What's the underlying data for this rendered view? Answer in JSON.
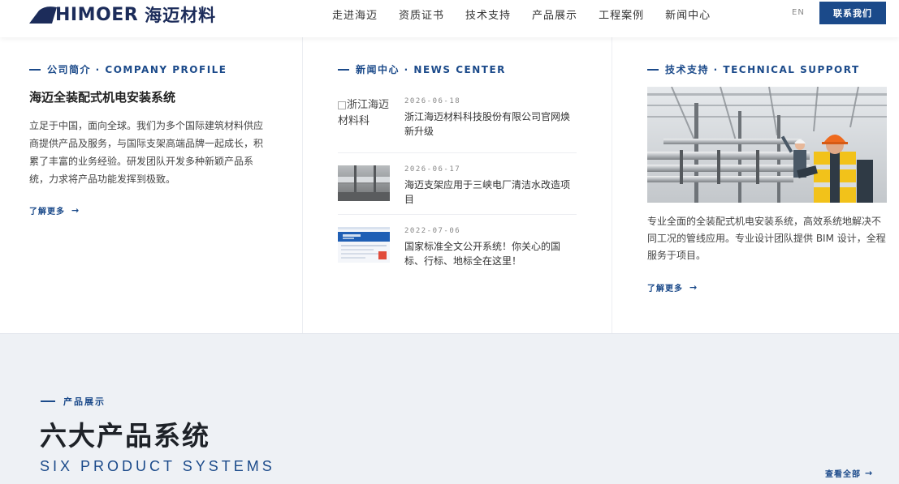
{
  "header": {
    "logo_text": "HIMOER",
    "logo_cn": "海迈材料",
    "nav": [
      "走进海迈",
      "资质证书",
      "技术支持",
      "产品展示",
      "工程案例",
      "新闻中心"
    ],
    "lang": "EN",
    "contact_label": "联系我们"
  },
  "company": {
    "section_title": "公司简介 · COMPANY PROFILE",
    "heading": "海迈全装配式机电安装系统",
    "description": "立足于中国，面向全球。我们为多个国际建筑材料供应商提供产品及服务，与国际支架高端品牌一起成长，积累了丰富的业务经验。研发团队开发多种新颖产品系统，力求将产品功能发挥到极致。",
    "more_label": "了解更多"
  },
  "news": {
    "section_title": "新闻中心 · NEWS CENTER",
    "items": [
      {
        "date": "2026-06-18",
        "title": "浙江海迈材料科技股份有限公司官网焕新升级",
        "thumb_alt": "浙江海迈材料科"
      },
      {
        "date": "2026-06-17",
        "title": "海迈支架应用于三峡电厂清洁水改造项目"
      },
      {
        "date": "2022-07-06",
        "title": "国家标准全文公开系统！你关心的国标、行标、地标全在这里！"
      }
    ]
  },
  "tech": {
    "section_title": "技术支持 · TECHNICAL SUPPORT",
    "description": "专业全面的全装配式机电安装系统，高效系统地解决不同工况的管线应用。专业设计团队提供 BIM 设计，全程服务于项目。",
    "more_label": "了解更多"
  },
  "products": {
    "label": "产品展示",
    "title": "六大产品系统",
    "subtitle": "SIX PRODUCT SYSTEMS",
    "view_all": "查看全部"
  },
  "colors": {
    "brand": "#1b4a8a",
    "logo": "#1c2c5a",
    "band_bg": "#eef1f5"
  }
}
